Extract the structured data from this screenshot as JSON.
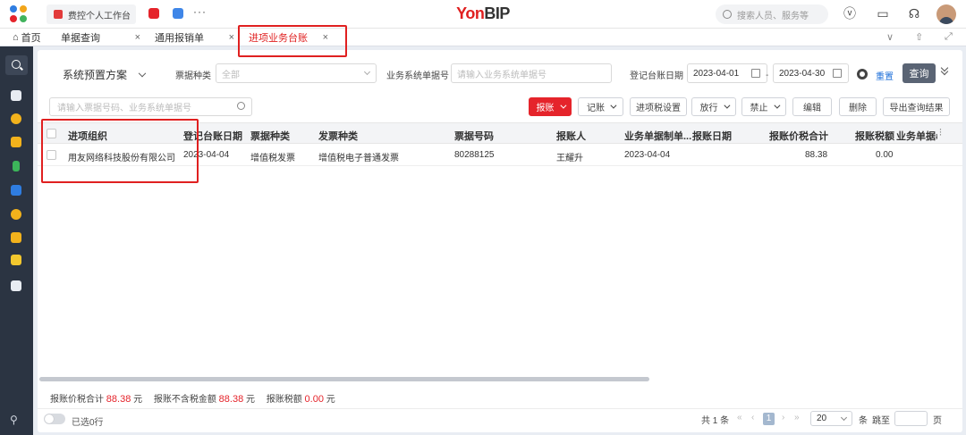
{
  "topbar": {
    "app_tab_label": "费控个人工作台",
    "brand_main": "Yon",
    "brand_sub": "BIP",
    "search_placeholder": "搜索人员、服务等",
    "more": "···"
  },
  "tabs": {
    "home": "首页",
    "items": [
      {
        "label": "单据查询",
        "close": "×"
      },
      {
        "label": "通用报销单",
        "close": "×"
      },
      {
        "label": "进项业务台账",
        "close": "×",
        "active": true
      }
    ]
  },
  "filters": {
    "scheme": "系统预置方案",
    "ticket_type_label": "票据种类",
    "ticket_type_value": "全部",
    "biz_no_label": "业务系统单据号",
    "biz_no_placeholder": "请输入业务系统单据号",
    "date_label": "登记台账日期",
    "date_from": "2023-04-01",
    "date_sep": "-",
    "date_to": "2023-04-30",
    "reset": "重置",
    "query": "查询"
  },
  "toolbar": {
    "search_placeholder": "请输入票据号码、业务系统单据号",
    "buttons": {
      "reimburse": "报账",
      "record": "记账",
      "tax_setting": "进项税设置",
      "release": "放行",
      "forbid": "禁止",
      "edit": "编辑",
      "delete": "删除",
      "export": "导出查询结果"
    }
  },
  "table": {
    "headers": [
      "进项组织",
      "登记台账日期",
      "票据种类",
      "发票种类",
      "票据号码",
      "报账人",
      "业务单据制单...",
      "报账日期",
      "报账价税合计",
      "报账税额",
      "业务单据#"
    ],
    "rows": [
      [
        "用友网络科技股份有限公司",
        "2023-04-04",
        "增值税发票",
        "增值税电子普通发票",
        "80288125",
        "王耀升",
        "2023-04-04",
        "",
        "88.38",
        "0.00",
        ""
      ]
    ]
  },
  "summary": {
    "total_label": "报账价税合计",
    "total_value": "88.38",
    "unit": "元",
    "net_label": "报账不含税金额",
    "net_value": "88.38",
    "tax_label": "报账税额",
    "tax_value": "0.00"
  },
  "footer": {
    "selected": "已选0行",
    "total": "共 1 条",
    "page": "1",
    "page_size": "20",
    "page_size_unit": "条",
    "jump_label": "跳至",
    "page_unit": "页"
  },
  "colors": {
    "accent_red": "#e5242b",
    "brand_red": "#e02020",
    "rail": "#2b3442",
    "annotation": "#e02020"
  }
}
